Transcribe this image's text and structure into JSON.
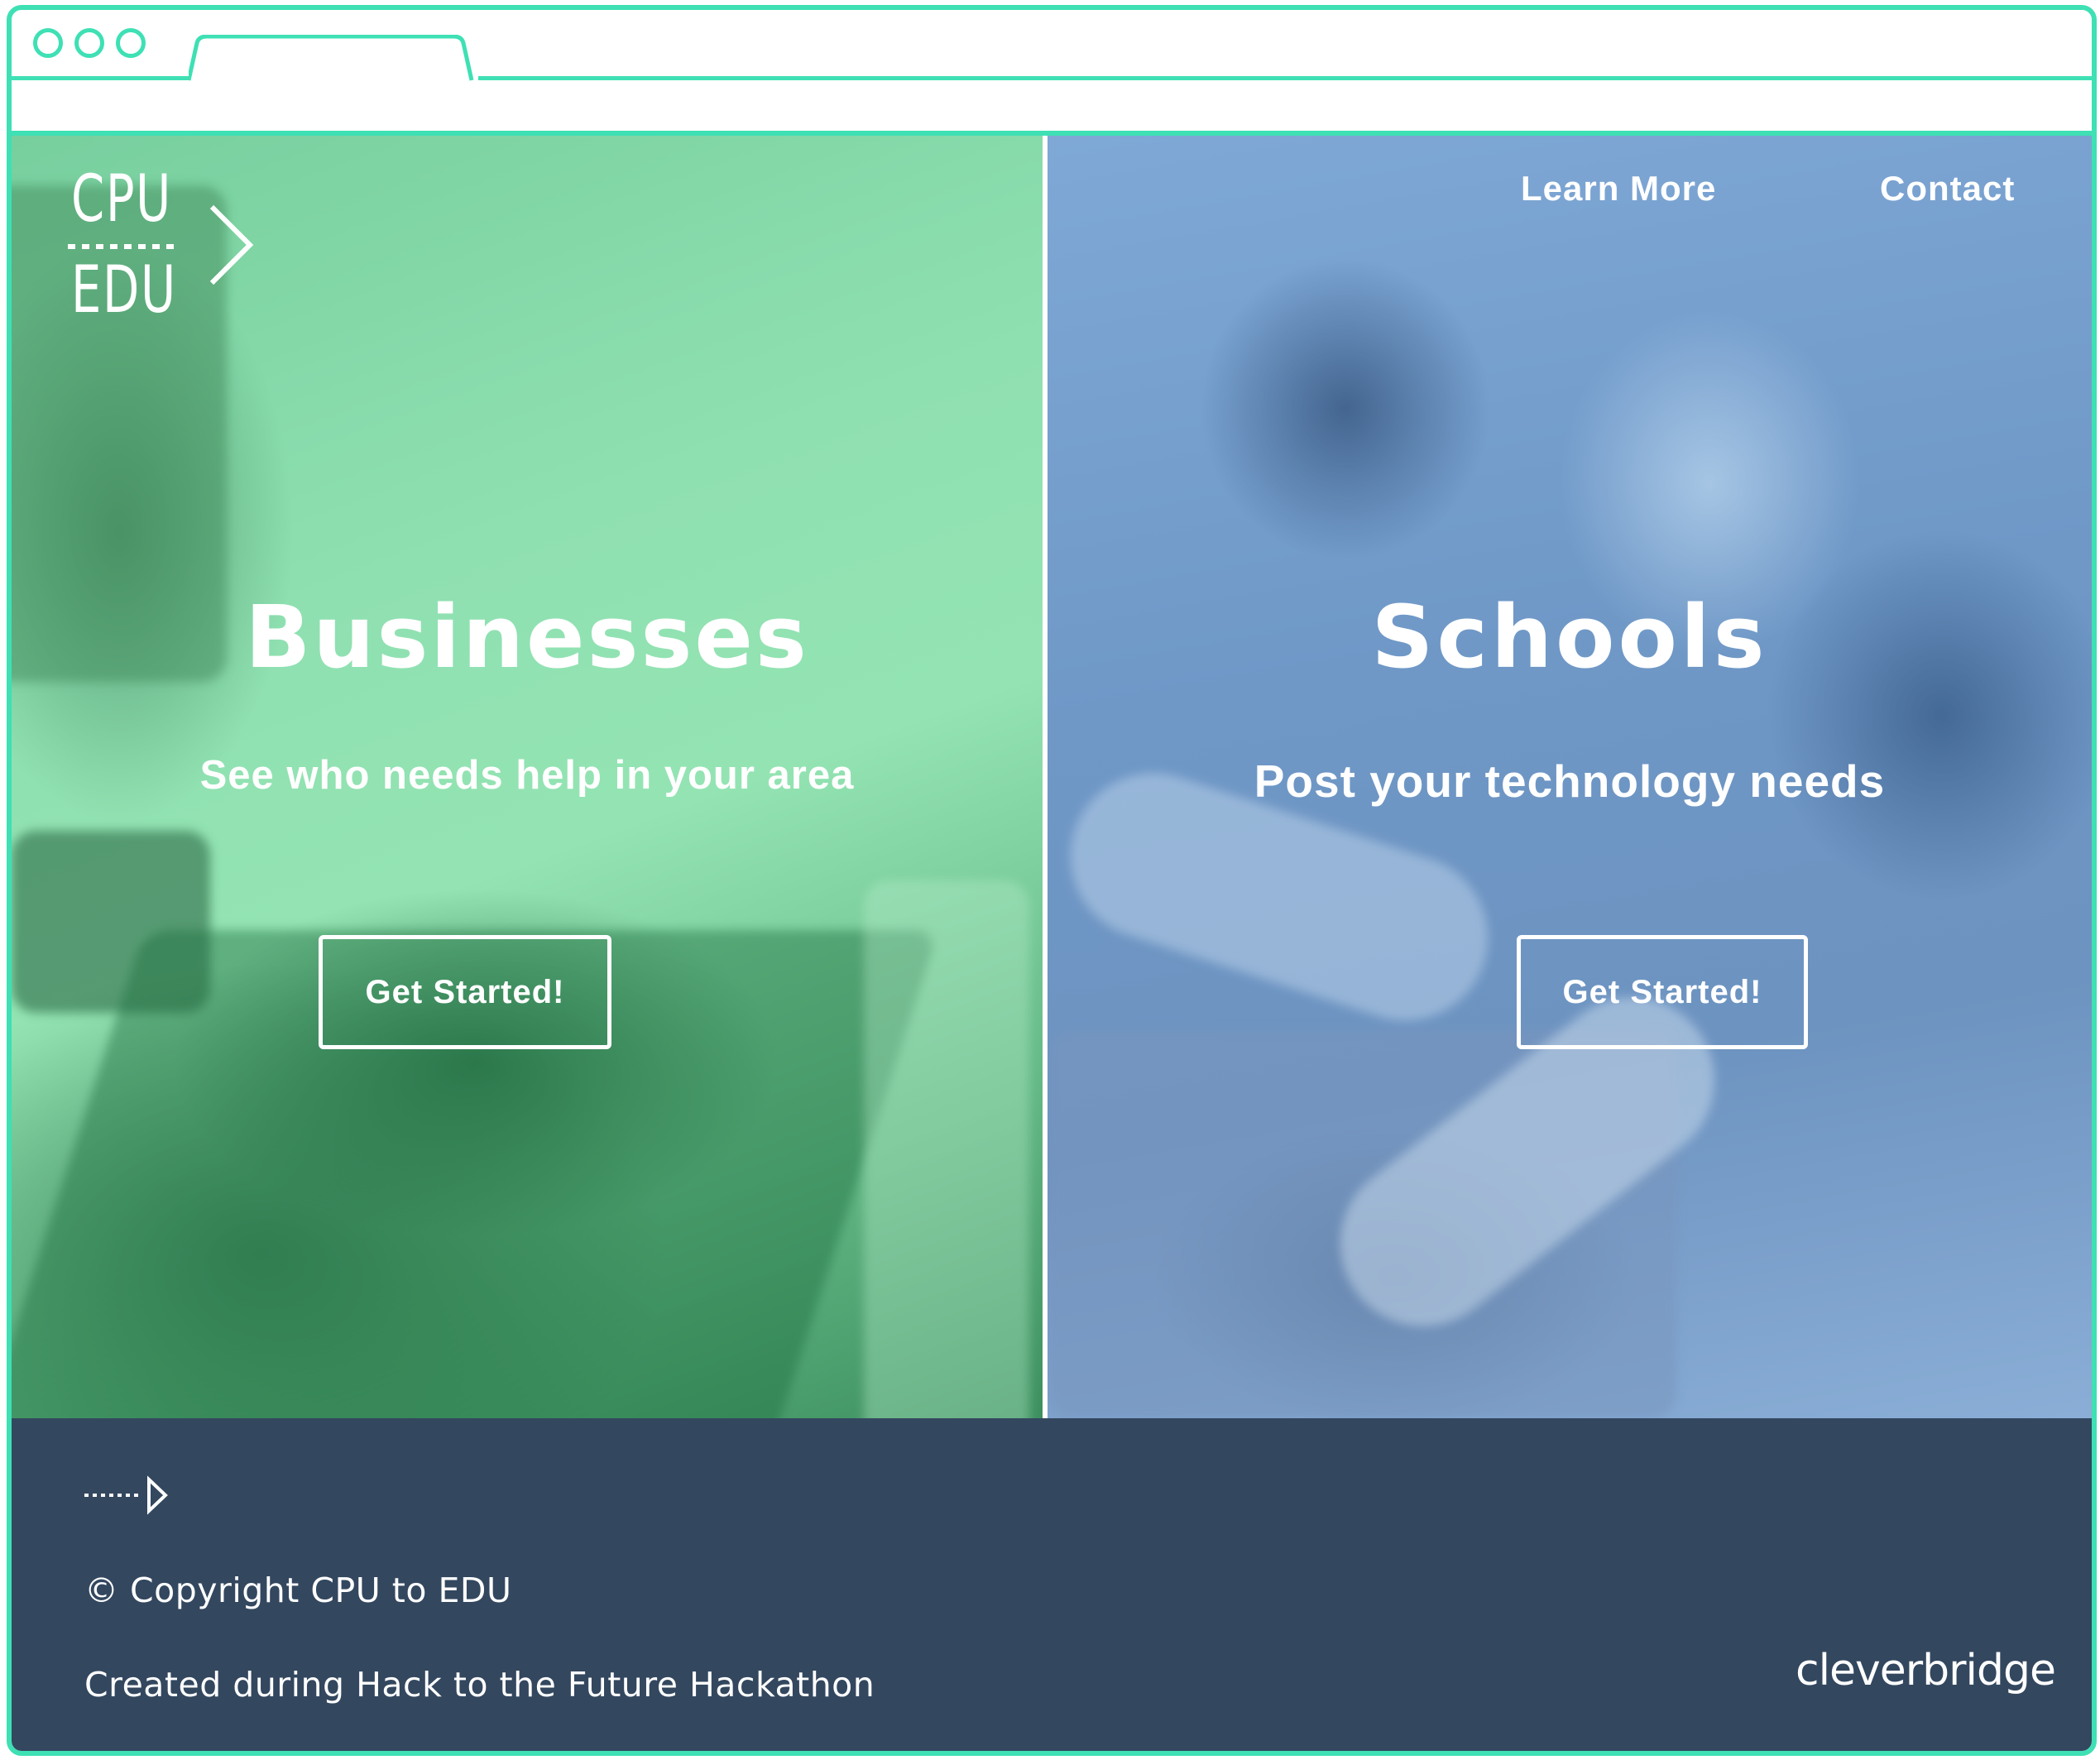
{
  "browser": {
    "window_dots": [
      "close",
      "minimize",
      "maximize"
    ]
  },
  "brand": {
    "logo_top": "CPU",
    "logo_bottom": "EDU"
  },
  "nav": {
    "learn_more": "Learn More",
    "contact": "Contact"
  },
  "businesses": {
    "title": "Businesses",
    "subtitle": "See who needs help in your area",
    "button": "Get Started!"
  },
  "schools": {
    "title": "Schools",
    "subtitle": "Post your technology needs",
    "button": "Get Started!"
  },
  "footer": {
    "copyright": "© Copyright CPU to EDU",
    "created": "Created during Hack to the Future Hackathon",
    "sponsor": "cleverbridge"
  },
  "colors": {
    "accent": "#3ee0b4",
    "businesses_tint": "#8fe0b1",
    "schools_tint": "#7fa8d6",
    "footer_bg": "#33475f"
  },
  "icons": {
    "logo_arrow": "play-arrow-icon",
    "footer_mark": "dotted-arrow-icon"
  }
}
